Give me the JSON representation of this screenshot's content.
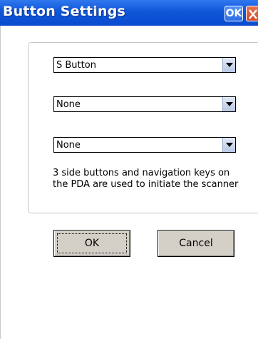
{
  "window": {
    "title": "Button Settings",
    "ok_label": "OK",
    "close_icon": "close-icon"
  },
  "combos": [
    {
      "value": "S Button",
      "arrow_icon": "chevron-down-icon"
    },
    {
      "value": "None",
      "arrow_icon": "chevron-down-icon"
    },
    {
      "value": "None",
      "arrow_icon": "chevron-down-icon"
    }
  ],
  "description": "3 side buttons and navigation keys on the PDA  are used to initiate the scanner",
  "buttons": {
    "ok_label": "OK",
    "cancel_label": "Cancel"
  },
  "colors": {
    "titlebar": "#0f56d8",
    "button_face": "#d4d0c8",
    "close_button": "#d24a2a"
  }
}
